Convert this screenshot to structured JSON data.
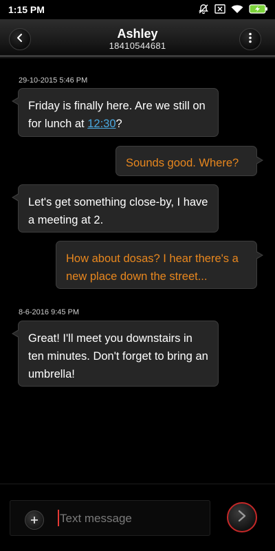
{
  "status_bar": {
    "time": "1:15 PM",
    "icons": [
      "mute-notifications-icon",
      "sim-x-icon",
      "wifi-icon",
      "battery-charging-icon"
    ],
    "battery_color": "#7cd33b"
  },
  "header": {
    "contact_name": "Ashley",
    "contact_number": "18410544681",
    "back_icon": "chevron-left-icon",
    "menu_icon": "more-vertical-icon"
  },
  "messages": [
    {
      "type": "timestamp",
      "text": "29-10-2015 5:46 PM"
    },
    {
      "type": "incoming",
      "text_before_link": "Friday is finally here. Are we still on for lunch at ",
      "link": "12:30",
      "text_after_link": "?"
    },
    {
      "type": "outgoing",
      "text": "Sounds good. Where?"
    },
    {
      "type": "incoming",
      "text": "Let's get something close-by, I have a meeting at 2."
    },
    {
      "type": "outgoing",
      "text": "How about dosas? I hear there's a new place down the street..."
    },
    {
      "type": "timestamp",
      "text": "8-6-2016 9:45 PM"
    },
    {
      "type": "incoming",
      "text": "Great! I'll meet you downstairs in ten minutes. Don't forget to bring an umbrella!"
    }
  ],
  "compose": {
    "placeholder": "Text message",
    "value": "",
    "attach_icon": "plus-icon",
    "send_icon": "chevron-right-icon"
  },
  "colors": {
    "outgoing_text": "#e8871e",
    "incoming_text": "#ffffff",
    "link": "#4aa8e0",
    "send_ring": "#c62828"
  }
}
